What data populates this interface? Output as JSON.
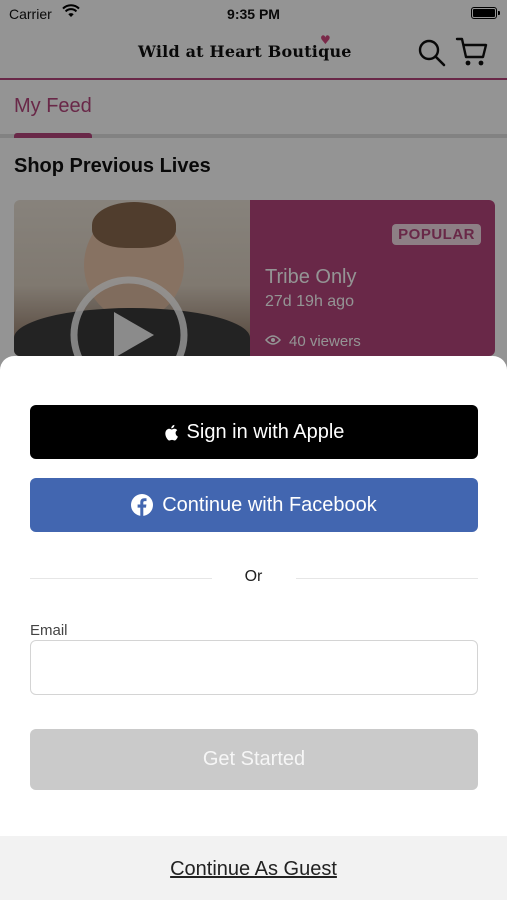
{
  "status_bar": {
    "carrier": "Carrier",
    "time": "9:35 PM"
  },
  "header": {
    "logo_text": "Wild  at Heart Boutique",
    "icons": [
      "search-icon",
      "cart-icon"
    ]
  },
  "tabs": [
    {
      "label": "My Feed",
      "active": true
    }
  ],
  "section": {
    "title": "Shop Previous Lives"
  },
  "live_card": {
    "badge": "POPULAR",
    "title": "Tribe Only",
    "ago": "27d 19h ago",
    "viewers": "40 viewers"
  },
  "sign_in": {
    "apple_label": "Sign in with Apple",
    "facebook_label": "Continue with Facebook",
    "or_label": "Or",
    "email_label": "Email",
    "email_value": "",
    "email_placeholder": "",
    "submit_label": "Get Started",
    "guest_label": "Continue As Guest"
  },
  "colors": {
    "brand": "#b5467d",
    "facebook": "#4266b0",
    "apple": "#000000",
    "disabled_button": "#cacaca"
  }
}
